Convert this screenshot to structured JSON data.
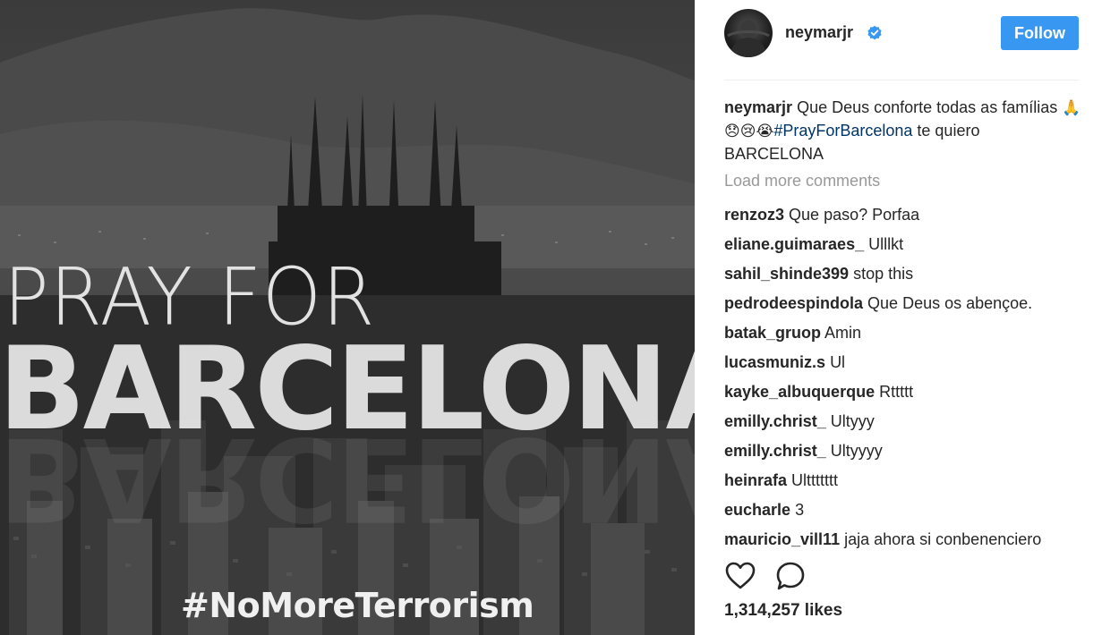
{
  "image": {
    "line1": "PRAY FOR",
    "line2": "BARCELONA",
    "hashtag": "#NoMoreTerrorism"
  },
  "header": {
    "username": "neymarjr",
    "verified": true,
    "follow_label": "Follow"
  },
  "caption": {
    "username": "neymarjr",
    "text_before": "Que Deus conforte todas as famílias",
    "emojis": "🙏😞😢😭",
    "hashtag": "#PrayForBarcelona",
    "text_after": "te quiero BARCELONA"
  },
  "load_more_label": "Load more comments",
  "comments": [
    {
      "user": "renzoz3",
      "text": "Que paso? Porfaa"
    },
    {
      "user": "eliane.guimaraes_",
      "text": "Ulllkt"
    },
    {
      "user": "sahil_shinde399",
      "text": "stop this"
    },
    {
      "user": "pedrodeespindola",
      "text": "Que Deus os abençoe."
    },
    {
      "user": "batak_gruop",
      "text": "Amin"
    },
    {
      "user": "lucasmuniz.s",
      "text": "Ul"
    },
    {
      "user": "kayke_albuquerque",
      "text": "Rttttt"
    },
    {
      "user": "emilly.christ_",
      "text": "Ultyyy"
    },
    {
      "user": "emilly.christ_",
      "text": "Ultyyyy"
    },
    {
      "user": "heinrafa",
      "text": "Ulttttttt"
    },
    {
      "user": "eucharle",
      "text": "3"
    },
    {
      "user": "mauricio_vill11",
      "text": "jaja ahora si conbenenciero"
    }
  ],
  "likes": "1,314,257 likes",
  "icons": {
    "like": "heart-icon",
    "comment": "comment-icon",
    "verified": "verified-badge-icon"
  },
  "colors": {
    "follow_button": "#3897f0",
    "hashtag_link": "#003569",
    "muted_text": "#999999",
    "verified_badge": "#3897f0"
  }
}
